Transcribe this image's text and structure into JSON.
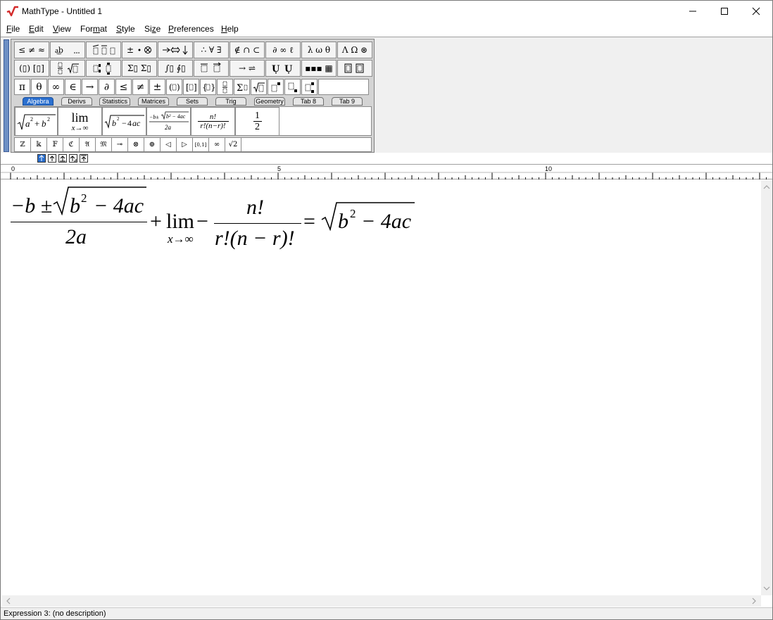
{
  "window": {
    "title": "MathType - Untitled 1",
    "accent_color": "#2a6fcf",
    "icon": "mathtype-radical-logo-icon"
  },
  "menu": [
    {
      "label": "File",
      "underline": "F",
      "rest": "ile"
    },
    {
      "label": "Edit",
      "underline": "E",
      "rest": "dit"
    },
    {
      "label": "View",
      "underline": "V",
      "rest": "iew"
    },
    {
      "label": "Format",
      "pre": "For",
      "underline": "m",
      "rest": "at"
    },
    {
      "label": "Style",
      "underline": "S",
      "rest": "tyle"
    },
    {
      "label": "Size",
      "pre": "Si",
      "underline": "z",
      "rest": "e"
    },
    {
      "label": "Preferences",
      "underline": "P",
      "rest": "references"
    },
    {
      "label": "Help",
      "underline": "H",
      "rest": "elp"
    }
  ],
  "palettes": {
    "row1": [
      "≤ ≠ ≈",
      "∴ ∀ ∃",
      "∉ ∩ ⊂",
      "∂ ∞ ℓ",
      "λ ω θ",
      "Λ Ω ⊛"
    ],
    "row2": [
      "(▯) [▯]",
      "Σ▯ Σ▯",
      "∫▯ ∮▯",
      "→ ⇌",
      "▪▪▪ ▦"
    ]
  },
  "symbol_bar": [
    "π",
    "θ",
    "∞",
    "∈",
    "→",
    "∂",
    "≤",
    "≠",
    "±"
  ],
  "tabs": [
    "Algebra",
    "Derivs",
    "Statistics",
    "Matrices",
    "Sets",
    "Trig",
    "Geometry",
    "Tab 8",
    "Tab 9"
  ],
  "active_tab": "Algebra",
  "templates": {
    "lim": "lim",
    "lim_sub": "x→∞",
    "half_num": "1",
    "half_den": "2",
    "fact_num": "n!",
    "fact_den": "r!(n−r)!"
  },
  "small_symbols": [
    "ℤ",
    "𝕜",
    "𝔽",
    "ℭ",
    "𝔄",
    "𝔐",
    "⊸",
    "⊗",
    "⊕",
    "◁",
    "▷",
    "[0,1]",
    "∞",
    "√2"
  ],
  "ruler": {
    "labels": [
      "0",
      "5",
      "10"
    ]
  },
  "equation": {
    "quad_num_prefix": "−b ±",
    "quad_radicand_b": "b",
    "quad_radicand_exp": "2",
    "quad_radicand_rest": "− 4ac",
    "quad_den": "2a",
    "plus": "+",
    "lim": "lim",
    "lim_sub": "x→∞",
    "minus": "−",
    "frac_num": "n!",
    "frac_den": "r!(n − r)!",
    "equals": "=",
    "rhs_b": "b",
    "rhs_exp": "2",
    "rhs_rest": "− 4ac"
  },
  "status": "Expression 3: (no description)"
}
